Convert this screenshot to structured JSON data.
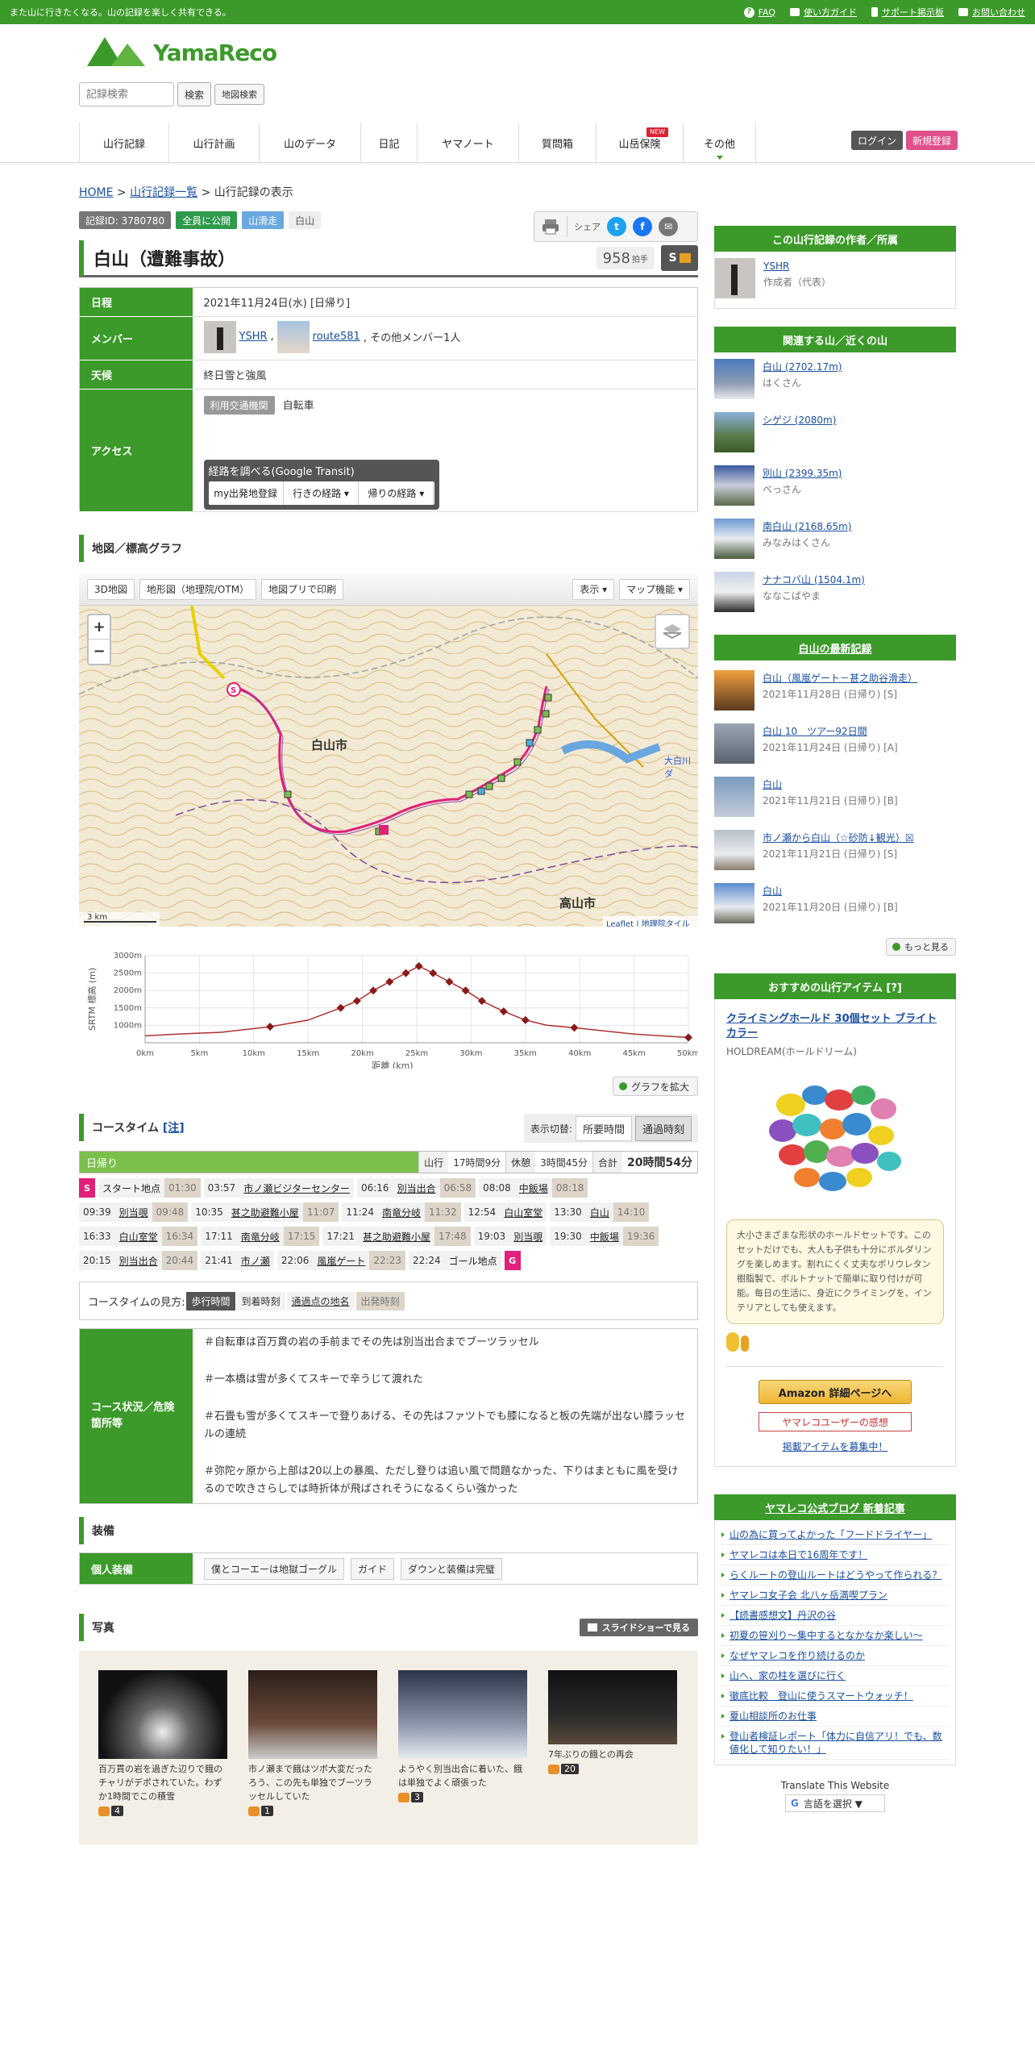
{
  "topbar": {
    "tagline": "また山に行きたくなる。山の記録を楽しく共有できる。",
    "links": [
      "FAQ",
      "使い方ガイド",
      "サポート掲示板",
      "お問い合わせ"
    ]
  },
  "header": {
    "logo": "YamaReco",
    "search_placeholder": "記録検索",
    "search_btn": "検索",
    "map_search_btn": "地図検索",
    "nav": [
      "山行記録",
      "山行計画",
      "山のデータ",
      "日記",
      "ヤマノート",
      "質問箱",
      "山岳保険",
      "その他"
    ],
    "new_badge": "NEW",
    "login": "ログイン",
    "register": "新規登録"
  },
  "breadcrumb": {
    "home": "HOME",
    "list": "山行記録一覧",
    "current": "山行記録の表示"
  },
  "badges": {
    "id": "記録ID: 3780780",
    "public": "全員に公開",
    "type": "山滑走",
    "area": "白山"
  },
  "share": {
    "label": "シェア"
  },
  "record": {
    "title": "白山（遭難事故）",
    "hand_count": "958",
    "hand_unit": "拍手",
    "grade": "S"
  },
  "info": {
    "date_label": "日程",
    "date": "2021年11月24日(水) [日帰り]",
    "member_label": "メンバー",
    "member1": "YSHR",
    "member2": "route581",
    "member_other": ", その他メンバー1人",
    "weather_label": "天候",
    "weather": "終日雪と強風",
    "access_label": "アクセス",
    "transport_chip": "利用交通機関",
    "transport": "自転車",
    "transit_title": "経路を調べる(Google Transit)",
    "transit_btns": [
      "my出発地登録",
      "行きの経路 ▾",
      "帰りの経路 ▾"
    ]
  },
  "map_section": {
    "title": "地図／標高グラフ",
    "tools": [
      "3D地図",
      "地形図（地理院/OTM）",
      "地図プリで印刷"
    ],
    "right_tools": [
      "表示 ▾",
      "マップ機能 ▾"
    ],
    "zoom_in": "+",
    "zoom_out": "−",
    "scale": "3 km",
    "attribution": "Leaflet | 地理院タイル",
    "place_hakusan": "白山市",
    "place_takayama": "高山市",
    "place_okubo": "大白川ダ",
    "expand_graph": "グラフを拡大"
  },
  "chart_data": {
    "type": "line",
    "xlabel": "距離 (km)",
    "ylabel": "SRTM 標高 (m)",
    "x_ticks": [
      "0km",
      "5km",
      "10km",
      "15km",
      "20km",
      "25km",
      "30km",
      "35km",
      "40km",
      "45km",
      "50km"
    ],
    "y_ticks": [
      "1000m",
      "1500m",
      "2000m",
      "2500m",
      "3000m"
    ],
    "ylim": [
      500,
      3000
    ],
    "xlim": [
      0,
      50
    ],
    "x": [
      0,
      3,
      7,
      11.5,
      15,
      18,
      19.5,
      21,
      22.5,
      24,
      25.2,
      26.5,
      28,
      29.5,
      31,
      33,
      35,
      37,
      39.5,
      45,
      50
    ],
    "y": [
      700,
      750,
      800,
      960,
      1150,
      1500,
      1700,
      2000,
      2250,
      2500,
      2700,
      2500,
      2250,
      2000,
      1700,
      1400,
      1150,
      1000,
      930,
      750,
      650
    ],
    "markers": [
      [
        11.5,
        960
      ],
      [
        18,
        1500
      ],
      [
        19.5,
        1700
      ],
      [
        21,
        2000
      ],
      [
        22.5,
        2250
      ],
      [
        24,
        2500
      ],
      [
        25.2,
        2700
      ],
      [
        26.5,
        2500
      ],
      [
        28,
        2250
      ],
      [
        29.5,
        2000
      ],
      [
        31,
        1700
      ],
      [
        33,
        1400
      ],
      [
        35,
        1150
      ],
      [
        39.5,
        930
      ],
      [
        50,
        650
      ]
    ]
  },
  "coursetime": {
    "title": "コースタイム",
    "note": "[注]",
    "toggle_label": "表示切替:",
    "toggle_a": "所要時間",
    "toggle_b": "通過時刻",
    "day": "日帰り",
    "k1": "山行",
    "v1": "17時間9分",
    "k2": "休憩",
    "v2": "3時間45分",
    "k3": "合計",
    "v3": "20時間54分",
    "start": "S",
    "goal": "G",
    "rows": [
      [
        [
          "",
          "スタート地点",
          "01:30",
          "plain"
        ],
        [
          "03:57",
          "市ノ瀬ビジターセンター",
          ""
        ],
        [
          "06:16",
          "別当出合",
          "06:58"
        ],
        [
          "08:08",
          "中飯場",
          "08:18"
        ]
      ],
      [
        [
          "09:39",
          "別当覗",
          "09:48"
        ],
        [
          "10:35",
          "甚之助避難小屋",
          "11:07"
        ],
        [
          "11:24",
          "南竜分岐",
          "11:32"
        ],
        [
          "12:54",
          "白山室堂",
          ""
        ],
        [
          "13:30",
          "白山",
          "14:10"
        ]
      ],
      [
        [
          "16:33",
          "白山室堂",
          "16:34"
        ],
        [
          "17:11",
          "南竜分岐",
          "17:15"
        ],
        [
          "17:21",
          "甚之助避難小屋",
          "17:48"
        ],
        [
          "19:03",
          "別当覗",
          ""
        ],
        [
          "19:30",
          "中飯場",
          "19:36"
        ]
      ],
      [
        [
          "20:15",
          "別当出合",
          "20:44"
        ],
        [
          "21:41",
          "市ノ瀬",
          ""
        ],
        [
          "22:06",
          "風嵐ゲート",
          "22:23"
        ],
        [
          "22:24",
          "ゴール地点",
          "",
          "plain"
        ]
      ]
    ],
    "legend_label": "コースタイムの見方:",
    "legend": [
      "歩行時間",
      "到着時刻",
      "通過点の地名",
      "出発時刻"
    ]
  },
  "condition": {
    "label": "コース状況／危険箇所等",
    "paragraphs": [
      "＃自転車は百万貫の岩の手前までその先は別当出合までブーツラッセル",
      "＃一本橋は雪が多くてスキーで辛うじて渡れた",
      "＃石畳も雪が多くてスキーで登りあげる、その先はファツトでも膝になると板の先端が出ない膝ラッセルの連続",
      "＃弥陀ヶ原から上部は20以上の暴風、ただし登りは追い風で問題なかった、下りはまともに風を受けるので吹きさらしでは時折体が飛ばされそうになるくらい強かった"
    ]
  },
  "equipment": {
    "title": "装備",
    "label": "個人装備",
    "tags": [
      "僕とコーエーは地獄ゴーグル",
      "ガイド",
      "ダウンと装備は完璧"
    ]
  },
  "photos": {
    "title": "写真",
    "slideshow": "スライドショーで見る",
    "items": [
      {
        "caption": "百万貫の岩を過ぎた辺りで餓のチャリがデポされていた。わずか1時間でこの積雪",
        "likes": "4"
      },
      {
        "caption": "市ノ瀬まで餓はツボ大変だったろう、この先も単独でブーツラッセルしていた",
        "likes": "1"
      },
      {
        "caption": "ようやく別当出合に着いた、餓は単独でよく頑張った",
        "likes": "3"
      },
      {
        "caption": "7年ぶりの餓との再会",
        "likes": "20"
      }
    ]
  },
  "sidebar": {
    "author_title": "この山行記録の作者／所属",
    "author_name": "YSHR",
    "author_role": "作成者（代表）",
    "mountains_title": "関連する山／近くの山",
    "mountains": [
      {
        "name": "白山 (2702.17m)",
        "kana": "はくさん"
      },
      {
        "name": "シゲジ (2080m)",
        "kana": ""
      },
      {
        "name": "別山 (2399.35m)",
        "kana": "べっさん"
      },
      {
        "name": "南白山 (2168.65m)",
        "kana": "みなみはくさん"
      },
      {
        "name": "ナナコバ山 (1504.1m)",
        "kana": "ななこばやま"
      }
    ],
    "latest_title": "白山の最新記録",
    "latest": [
      {
        "name": "白山（風嵐ゲート－甚之助谷滑走）",
        "date": "2021年11月28日 (日帰り) [S]"
      },
      {
        "name": "白山 10　ツアー92日間",
        "date": "2021年11月24日 (日帰り) [A]"
      },
      {
        "name": "白山",
        "date": "2021年11月21日 (日帰り) [B]"
      },
      {
        "name": "市ノ瀬から白山（☆砂防↓観光）☒",
        "date": "2021年11月21日 (日帰り) [S]"
      },
      {
        "name": "白山",
        "date": "2021年11月20日 (日帰り) [B]"
      }
    ],
    "more": "もっと見る",
    "item_title": "おすすめの山行アイテム [?]",
    "item_name": "クライミングホールド 30個セット ブライトカラー",
    "item_maker": "HOLDREAM(ホールドリーム)",
    "item_desc": "大小さまざまな形状のホールドセットです。このセットだけでも、大人も子供も十分にボルダリングを楽しめます。割れにくく丈夫なポリウレタン樹脂製で、ボルトナットで簡単に取り付けが可能。毎日の生活に、身近にクライミングを、インテリアとしても使えます。",
    "amazon": "Amazon 詳細ページへ",
    "review": "ヤマレコユーザーの感想",
    "recruit": "掲載アイテムを募集中！",
    "blog_title": "ヤマレコ公式ブログ 新着記事",
    "blog": [
      "山の為に買ってよかった「フードドライヤー」",
      "ヤマレコは本日で16周年です！",
      "らくルートの登山ルートはどうやって作られる？",
      "ヤマレコ女子会 北八ヶ岳満喫プラン",
      "【読書感想文】丹沢の谷",
      "初夏の笹刈り～集中するとなかなか楽しい～",
      "なぜヤマレコを作り続けるのか",
      "山へ、家の柱を選びに行く",
      "徹底比較　登山に使うスマートウォッチ！",
      "夏山相談所のお仕事",
      "登山者検証レポート「体力に自信アリ！でも、数値化して知りたい！」"
    ],
    "translate_title": "Translate This Website",
    "translate_btn": "言語を選択 ▼"
  }
}
